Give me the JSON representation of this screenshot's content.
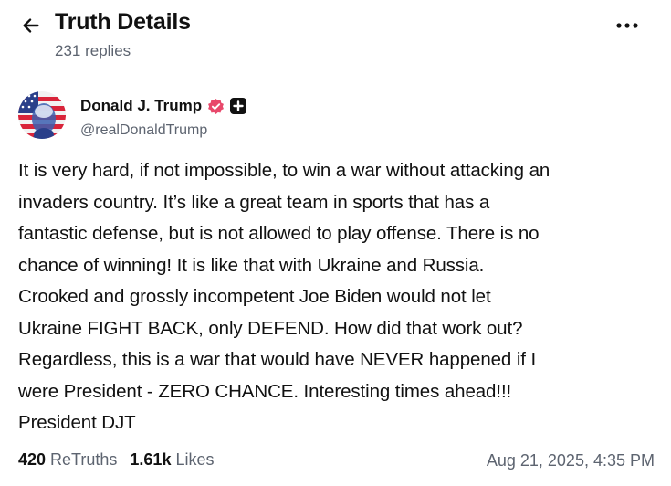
{
  "header": {
    "title": "Truth Details",
    "reply_count": "231 replies",
    "back_icon": "arrow-left-icon",
    "more_icon": "more-horizontal-icon"
  },
  "post": {
    "author": {
      "display_name": "Donald J. Trump",
      "handle": "@realDonaldTrump",
      "verified_icon": "verified-badge-icon",
      "verified_color": "#e8486b",
      "extra_badge_icon": "plus-badge-icon"
    },
    "body_lines": [
      "It is very hard, if not impossible, to win a war without attacking an",
      "invaders country. It’s like a great team in sports that has a",
      "fantastic defense, but is not allowed to play offense. There is no",
      "chance of winning! It is like that with Ukraine and Russia.",
      "Crooked and grossly incompetent Joe Biden would not let",
      "Ukraine FIGHT BACK, only DEFEND. How did that work out?",
      "Regardless, this is a war that would have NEVER happened if I",
      "were President - ZERO CHANCE. Interesting times ahead!!!",
      "President DJT"
    ],
    "stats": {
      "retruths_count": "420",
      "retruths_label": "ReTruths",
      "likes_count": "1.61k",
      "likes_label": "Likes"
    },
    "timestamp": "Aug 21, 2025, 4:35 PM"
  }
}
